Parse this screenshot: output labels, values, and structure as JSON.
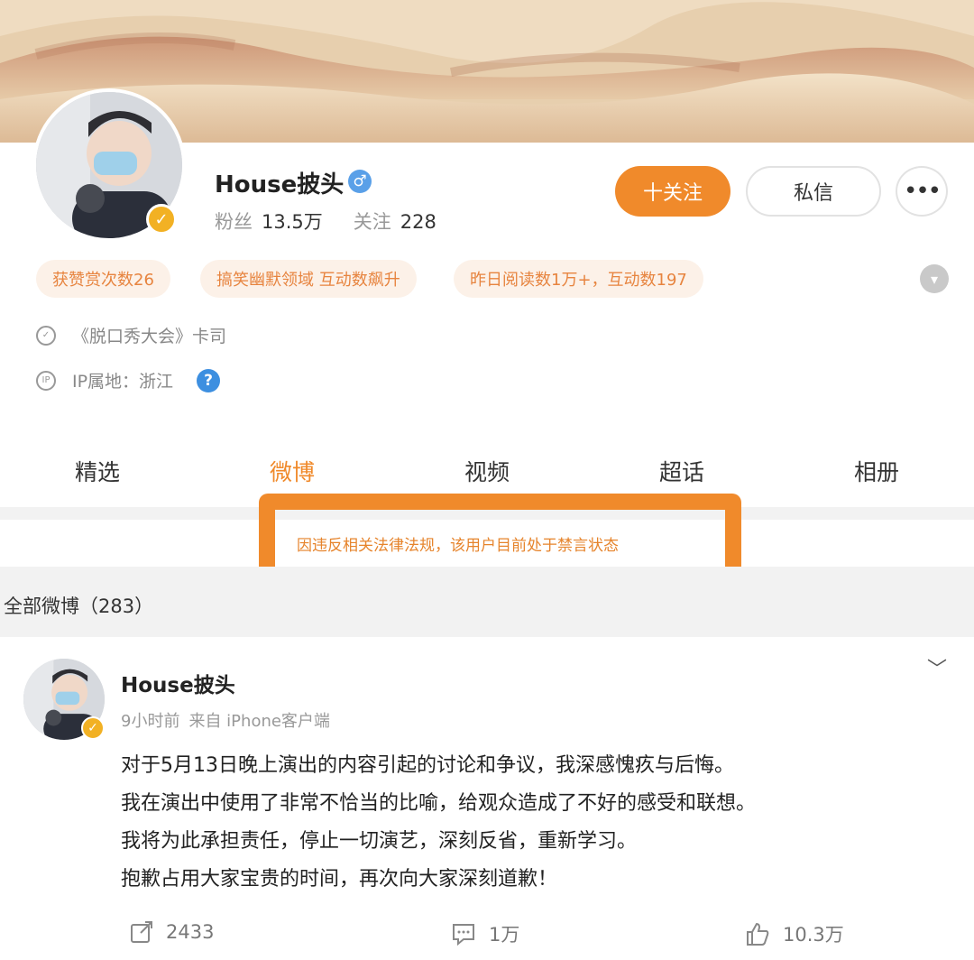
{
  "profile": {
    "name": "House披头",
    "fans_label": "粉丝",
    "fans_count": "13.5万",
    "following_label": "关注",
    "following_count": "228",
    "follow_button": "十关注",
    "message_button": "私信",
    "more_button": "•••"
  },
  "tags": [
    "获赞赏次数26",
    "搞笑幽默领域 互动数飙升",
    "昨日阅读数1万+，互动数197"
  ],
  "info": {
    "title": "《脱口秀大会》卡司",
    "ip": "IP属地：浙江"
  },
  "tabs": [
    "精选",
    "微博",
    "视频",
    "超话",
    "相册"
  ],
  "notice": "因违反相关法律法规，该用户目前处于禁言状态",
  "all_weibo": "全部微博（283）",
  "post": {
    "author": "House披头",
    "time": "9小时前",
    "source": "来自 iPhone客户端",
    "lines": [
      "对于5月13日晚上演出的内容引起的讨论和争议，我深感愧疚与后悔。",
      "我在演出中使用了非常不恰当的比喻，给观众造成了不好的感受和联想。",
      "我将为此承担责任，停止一切演艺，深刻反省，重新学习。",
      "抱歉占用大家宝贵的时间，再次向大家深刻道歉！"
    ],
    "reposts": "2433",
    "comments": "1万",
    "likes": "10.3万"
  },
  "colors": {
    "accent": "#f08a2b",
    "tag_bg": "#fcf1e8",
    "tag_text": "#e7843f",
    "verify": "#f2b124"
  },
  "icons": [
    "verified-badge-icon",
    "male-gender-icon",
    "expand-chevron-icon",
    "shield-icon",
    "ip-icon",
    "question-icon",
    "dropdown-chevron-icon",
    "repost-icon",
    "comment-icon",
    "like-icon"
  ]
}
